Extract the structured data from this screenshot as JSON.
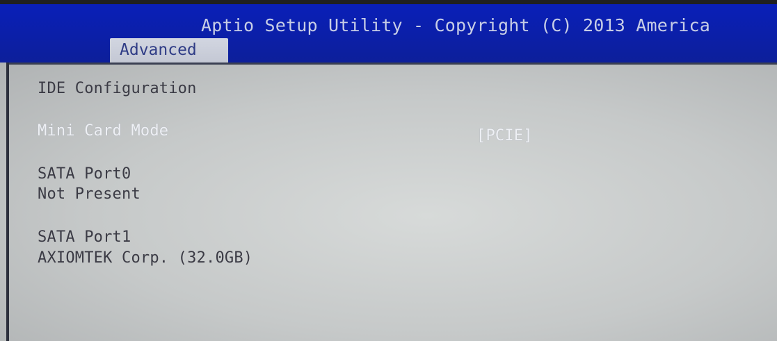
{
  "header": {
    "title": "Aptio Setup Utility - Copyright (C) 2013 America",
    "tabs": [
      {
        "label": "Advanced",
        "selected": true
      }
    ]
  },
  "main": {
    "section_title": "IDE Configuration",
    "settings": [
      {
        "label": "Mini Card Mode",
        "value": "[PCIE]",
        "selected": true
      }
    ],
    "ports": [
      {
        "label": "SATA Port0",
        "status": "Not Present"
      },
      {
        "label": "SATA Port1",
        "status": "AXIOMTEK Corp. (32.0GB)"
      }
    ]
  },
  "colors": {
    "header_bg": "#0b1fb0",
    "tab_bg": "#cfd3de",
    "content_bg": "#c9cccc",
    "text_normal": "#3b3b45",
    "text_highlight": "#eef0f4"
  }
}
